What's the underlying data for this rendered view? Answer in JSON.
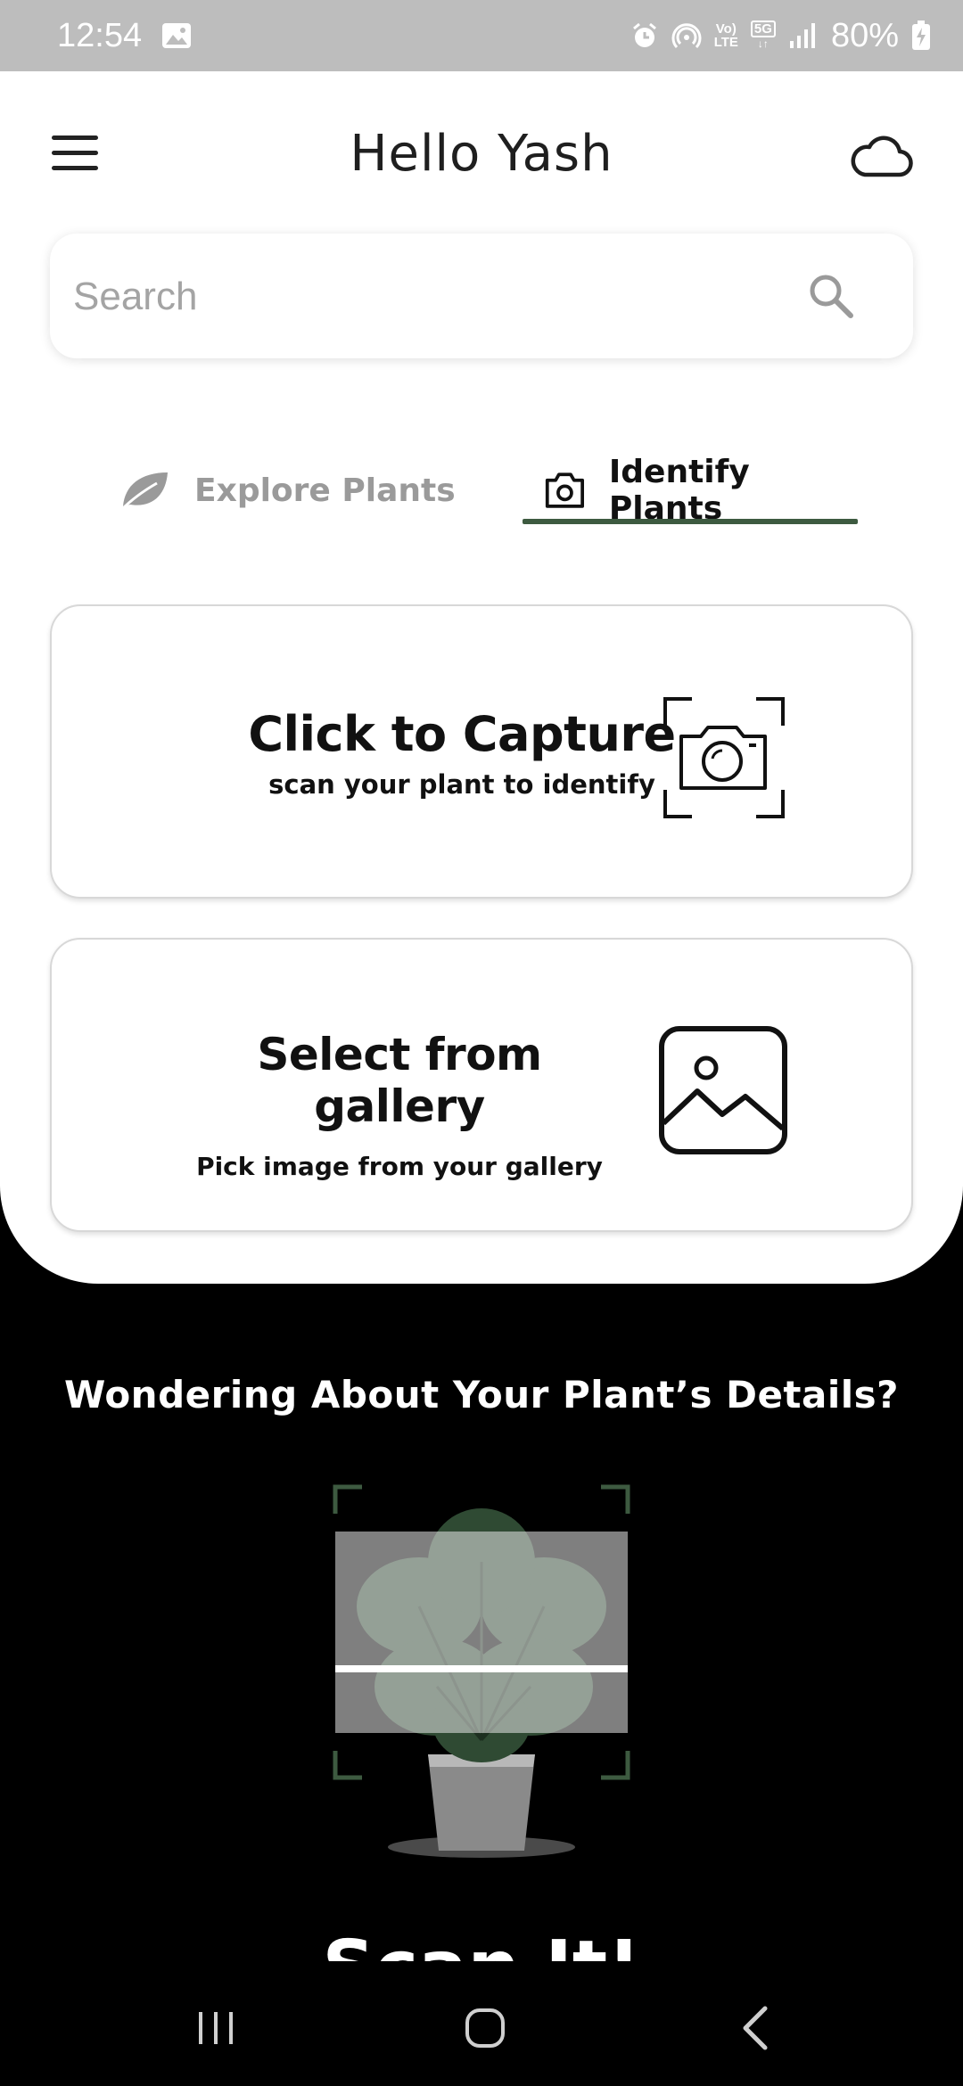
{
  "status_bar": {
    "time": "12:54",
    "network_small_top": "Vo)",
    "network_small_bottom": "LTE",
    "signal_label": "5G",
    "battery": "80%"
  },
  "header": {
    "title": "Hello Yash"
  },
  "search": {
    "placeholder": "Search",
    "value": ""
  },
  "tabs": [
    {
      "label": "Explore Plants",
      "active": false
    },
    {
      "label": "Identify Plants",
      "active": true
    }
  ],
  "actions": {
    "capture": {
      "title": "Click to Capture",
      "subtitle": "scan your plant to identify"
    },
    "gallery": {
      "title": "Select from gallery",
      "subtitle": "Pick image from your gallery"
    }
  },
  "promo": {
    "heading": "Wondering About Your Plant’s Details?",
    "scan_text": "Scan It!"
  },
  "colors": {
    "accent": "#3d5a40",
    "status_bar_bg": "#bdbdbd",
    "dark_bg": "#000000"
  },
  "icons": {
    "menu": "hamburger-icon",
    "cloud": "cloud-icon",
    "search": "search-icon",
    "explore": "leaf-icon",
    "identify": "camera-icon",
    "capture": "camera-scan-icon",
    "gallery": "image-icon"
  }
}
